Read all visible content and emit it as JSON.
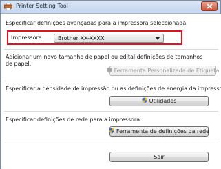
{
  "window": {
    "title": "Printer Setting Tool"
  },
  "header": {
    "description": "Especificar definições avançadas para a impressora seleccionada."
  },
  "printer": {
    "label": "Impressora:",
    "selected": "Brother XX-XXXX"
  },
  "sections": {
    "paper": {
      "line1": "Adicionar um novo tamanho de papel ou edital definições de tamanhos",
      "line2": "de papel.",
      "button": "Ferramenta Personalizada de Etiqueta"
    },
    "density": {
      "text": "Especificar a densidade de impressão ou as definições de energia da impressora.",
      "button": "Utilidades"
    },
    "network": {
      "text": "Especificar definições de rede para a impressora.",
      "button": "Ferramenta de definições da rede"
    }
  },
  "footer": {
    "exit_button": "Sair"
  },
  "icons": {
    "app": "printer-icon",
    "close": "close-icon",
    "shield": "shield-icon",
    "dropdown": "chevron-down-icon"
  },
  "colors": {
    "highlight": "#e0121e",
    "close_button": "#c9553a"
  }
}
